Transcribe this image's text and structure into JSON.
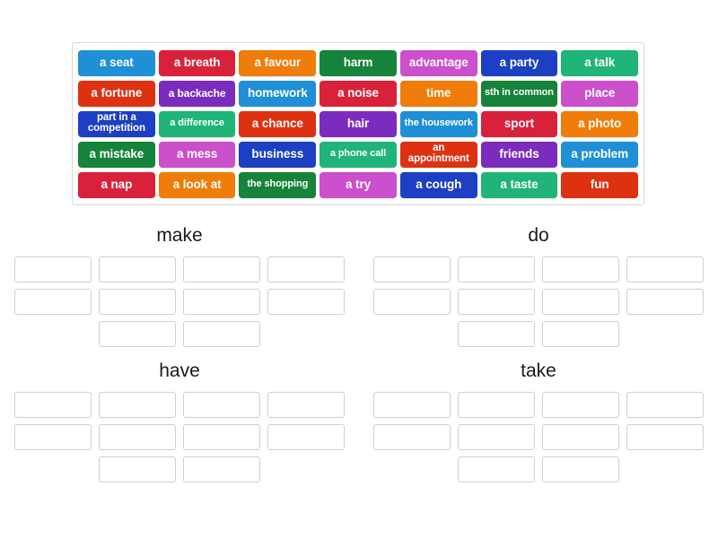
{
  "activity": {
    "type": "group-sort",
    "tile_bank": {
      "rows": [
        [
          {
            "label": "a seat",
            "color": "#1f8fd6"
          },
          {
            "label": "a breath",
            "color": "#d9213c"
          },
          {
            "label": "a favour",
            "color": "#f07c0a"
          },
          {
            "label": "harm",
            "color": "#16833a"
          },
          {
            "label": "advantage",
            "color": "#cc4fcc"
          },
          {
            "label": "a party",
            "color": "#1c3fc4"
          },
          {
            "label": "a talk",
            "color": "#1fb478"
          }
        ],
        [
          {
            "label": "a fortune",
            "color": "#dd3112"
          },
          {
            "label": "a backache",
            "color": "#7b2cbf"
          },
          {
            "label": "homework",
            "color": "#1f8fd6"
          },
          {
            "label": "a noise",
            "color": "#d9213c"
          },
          {
            "label": "time",
            "color": "#f07c0a"
          },
          {
            "label": "sth in common",
            "color": "#16833a"
          },
          {
            "label": "place",
            "color": "#cc4fcc"
          }
        ],
        [
          {
            "label": "part in a competition",
            "color": "#1c3fc4"
          },
          {
            "label": "a difference",
            "color": "#1fb478"
          },
          {
            "label": "a chance",
            "color": "#dd3112"
          },
          {
            "label": "hair",
            "color": "#7b2cbf"
          },
          {
            "label": "the housework",
            "color": "#1f8fd6"
          },
          {
            "label": "sport",
            "color": "#d9213c"
          },
          {
            "label": "a photo",
            "color": "#f07c0a"
          }
        ],
        [
          {
            "label": "a mistake",
            "color": "#16833a"
          },
          {
            "label": "a mess",
            "color": "#cc4fcc"
          },
          {
            "label": "business",
            "color": "#1c3fc4"
          },
          {
            "label": "a phone call",
            "color": "#1fb478"
          },
          {
            "label": "an appointment",
            "color": "#dd3112"
          },
          {
            "label": "friends",
            "color": "#7b2cbf"
          },
          {
            "label": "a problem",
            "color": "#1f8fd6"
          }
        ],
        [
          {
            "label": "a nap",
            "color": "#d9213c"
          },
          {
            "label": "a look at",
            "color": "#f07c0a"
          },
          {
            "label": "the shopping",
            "color": "#16833a"
          },
          {
            "label": "a try",
            "color": "#cc4fcc"
          },
          {
            "label": "a cough",
            "color": "#1c3fc4"
          },
          {
            "label": "a taste",
            "color": "#1fb478"
          },
          {
            "label": "fun",
            "color": "#dd3112"
          }
        ]
      ]
    },
    "categories": [
      {
        "title": "make",
        "slot_rows": [
          4,
          4,
          2
        ]
      },
      {
        "title": "do",
        "slot_rows": [
          4,
          4,
          2
        ]
      },
      {
        "title": "have",
        "slot_rows": [
          4,
          4,
          2
        ]
      },
      {
        "title": "take",
        "slot_rows": [
          4,
          4,
          2
        ]
      }
    ]
  }
}
